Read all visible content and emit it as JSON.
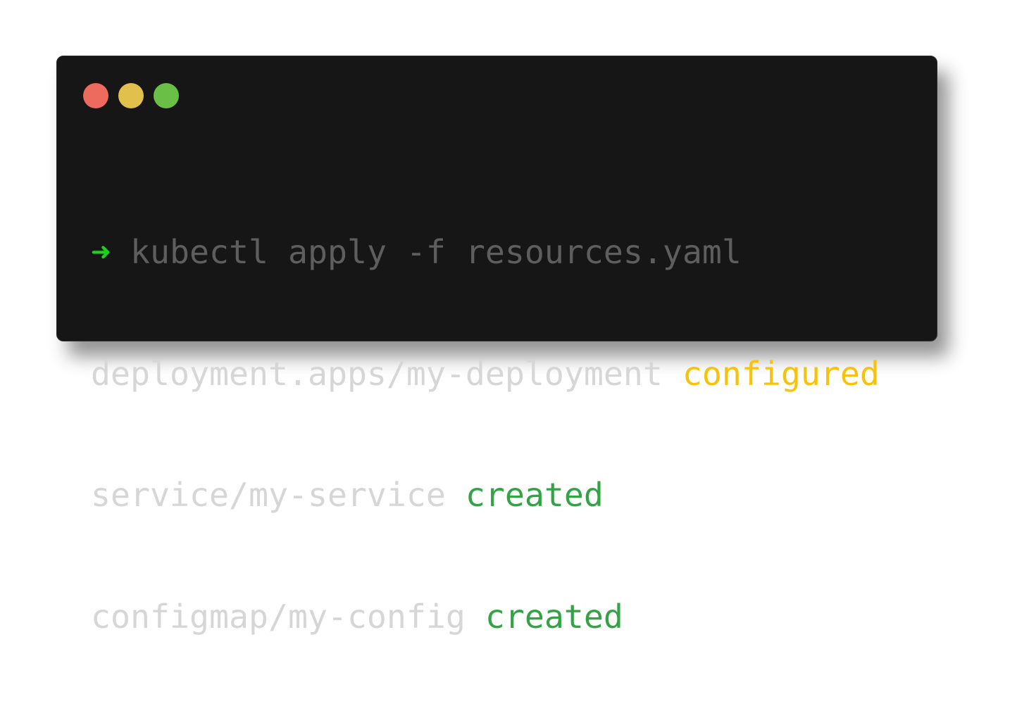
{
  "window": {
    "controls": [
      {
        "name": "close",
        "color": "#ed6a5e"
      },
      {
        "name": "minimize",
        "color": "#e2c04c"
      },
      {
        "name": "maximize",
        "color": "#6ac046"
      }
    ]
  },
  "terminal": {
    "prompt_symbol": "➜",
    "command": "kubectl apply -f resources.yaml",
    "output": [
      {
        "resource": "deployment.apps/my-deployment",
        "status": "configured"
      },
      {
        "resource": "service/my-service",
        "status": "created"
      },
      {
        "resource": "configmap/my-config",
        "status": "created"
      }
    ]
  },
  "colors": {
    "background": "#161616",
    "prompt": "#1ed01e",
    "command": "#5e5e5e",
    "output_text": "#d6d6d6",
    "status_configured": "#f6c20b",
    "status_created": "#33a346"
  }
}
